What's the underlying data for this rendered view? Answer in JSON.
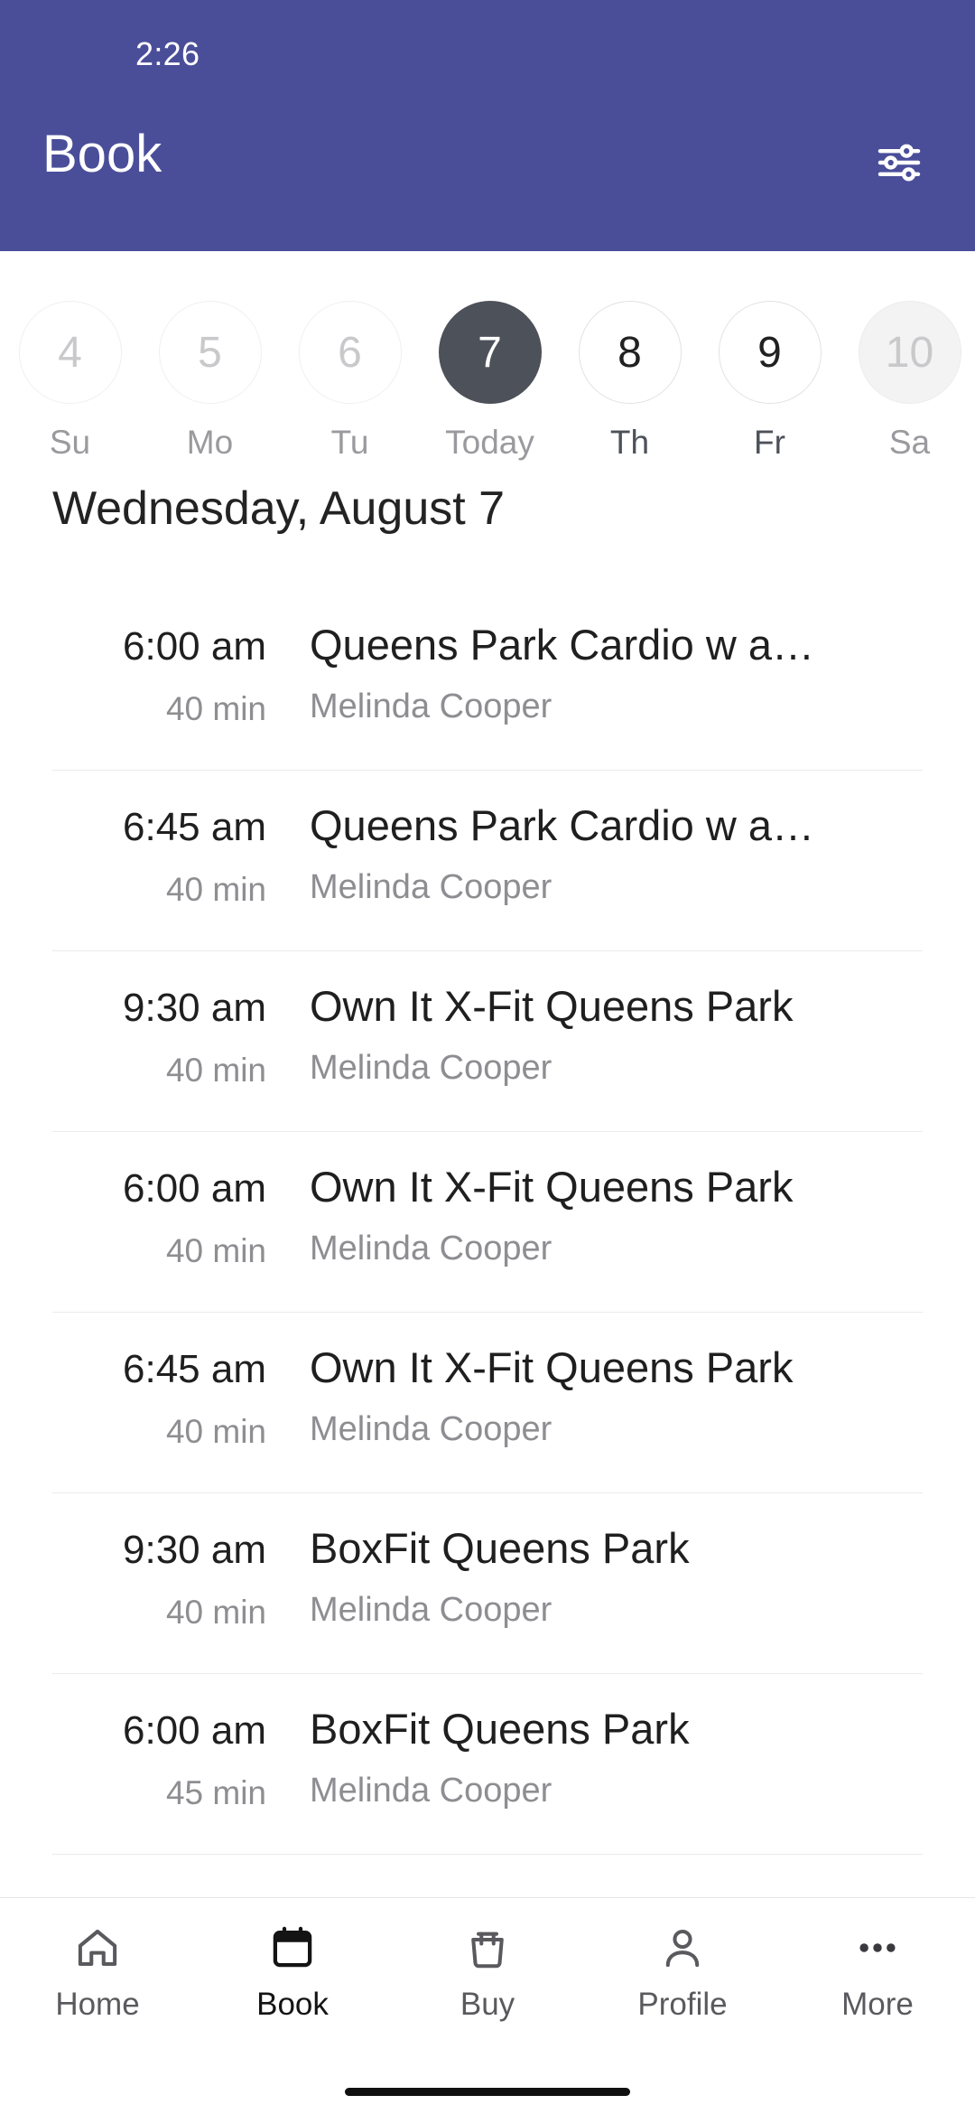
{
  "status_bar": {
    "time": "2:26"
  },
  "header": {
    "title": "Book",
    "background_color": "#4a4e99",
    "filter_icon": "sliders-filter-icon"
  },
  "date_strip": {
    "days": [
      {
        "number": "4",
        "label": "Su",
        "state": "past"
      },
      {
        "number": "5",
        "label": "Mo",
        "state": "past"
      },
      {
        "number": "6",
        "label": "Tu",
        "state": "past"
      },
      {
        "number": "7",
        "label": "Today",
        "state": "selected"
      },
      {
        "number": "8",
        "label": "Th",
        "state": "available"
      },
      {
        "number": "9",
        "label": "Fr",
        "state": "available"
      },
      {
        "number": "10",
        "label": "Sa",
        "state": "trailing"
      }
    ],
    "selected_color": "#4d5159"
  },
  "day_heading": "Wednesday, August 7",
  "classes": [
    {
      "time": "6:00 am",
      "duration": "40 min",
      "title": "Queens Park Cardio w a…",
      "instructor": "Melinda Cooper"
    },
    {
      "time": "6:45 am",
      "duration": "40 min",
      "title": "Queens Park Cardio w a…",
      "instructor": "Melinda Cooper"
    },
    {
      "time": "9:30 am",
      "duration": "40 min",
      "title": "Own It X-Fit Queens Park",
      "instructor": "Melinda Cooper"
    },
    {
      "time": "6:00 am",
      "duration": "40 min",
      "title": "Own It X-Fit Queens Park",
      "instructor": "Melinda Cooper"
    },
    {
      "time": "6:45 am",
      "duration": "40 min",
      "title": "Own It X-Fit Queens Park",
      "instructor": "Melinda Cooper"
    },
    {
      "time": "9:30 am",
      "duration": "40 min",
      "title": "BoxFit Queens Park",
      "instructor": "Melinda Cooper"
    },
    {
      "time": "6:00 am",
      "duration": "45 min",
      "title": "BoxFit Queens Park",
      "instructor": "Melinda Cooper"
    }
  ],
  "bottom_nav": {
    "items": [
      {
        "label": "Home",
        "icon": "home-icon",
        "active": false
      },
      {
        "label": "Book",
        "icon": "calendar-icon",
        "active": true
      },
      {
        "label": "Buy",
        "icon": "shopping-bag-icon",
        "active": false
      },
      {
        "label": "Profile",
        "icon": "person-icon",
        "active": false
      },
      {
        "label": "More",
        "icon": "ellipsis-icon",
        "active": false
      }
    ]
  }
}
